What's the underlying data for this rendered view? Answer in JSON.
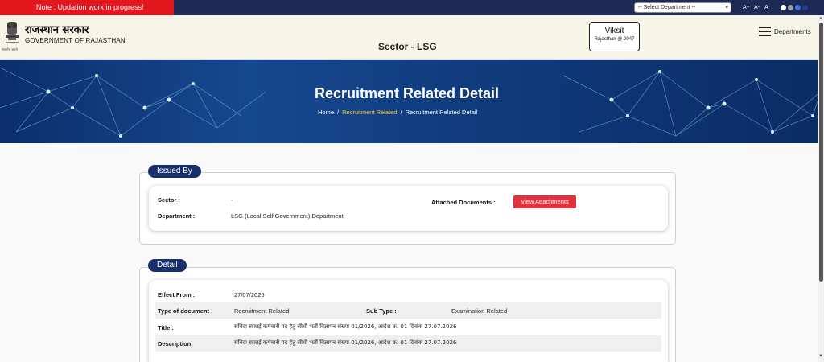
{
  "topbar": {
    "note": "Note : Updation work in progress!",
    "department_select": "-- Select Department --",
    "font_increase": "A+",
    "font_decrease": "A-",
    "font_reset": "A",
    "theme_colors": [
      "#ffffff",
      "#9aa0a6",
      "#3d6fd9",
      "#2a3a8a"
    ]
  },
  "header": {
    "brand_hindi": "राजस्थान सरकार",
    "brand_english": "GOVERNMENT OF RAJASTHAN",
    "emblem_caption": "सत्यमेव जयते",
    "sector_title": "Sector - LSG",
    "viksit_title": "Viksit",
    "viksit_subtitle": "Rajasthan @ 2047",
    "menu_label": "Departments"
  },
  "banner": {
    "title": "Recruitment Related Detail",
    "breadcrumb": [
      "Home",
      "Recruitment Related",
      "Recruitment Related Detail"
    ]
  },
  "issued_by": {
    "heading": "Issued By",
    "sector_label": "Sector :",
    "sector_value": "-",
    "department_label": "Department :",
    "department_value": "LSG (Local Self Government) Department",
    "attached_label": "Attached Documents :",
    "attach_button": "View Attachments"
  },
  "detail": {
    "heading": "Detail",
    "effect_from_label": "Effect From :",
    "effect_from_value": "27/07/2026",
    "doc_type_label": "Type of document :",
    "doc_type_value": "Recruitment Related",
    "sub_type_label": "Sub Type :",
    "sub_type_value": "Examination Related",
    "title_label": "Title :",
    "title_value": "संविदा सफाई कर्मचारी पद हेतु सीधी भर्ती विज्ञापन संख्या 01/2026, आदेश क्र. 01 दिनांक 27.07.2026",
    "description_label": "Description:",
    "description_value": "संविदा सफाई कर्मचारी पद हेतु सीधी भर्ती विज्ञापन संख्या 01/2026, आदेश क्र. 01 दिनांक 27.07.2026"
  }
}
